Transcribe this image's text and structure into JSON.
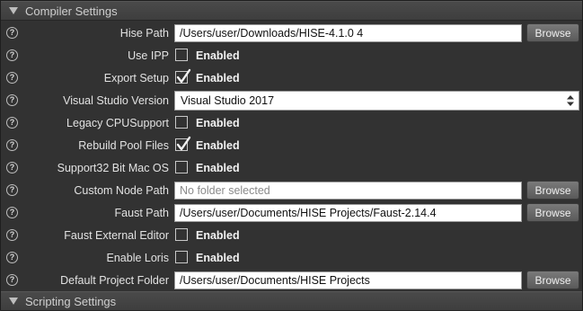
{
  "sections": {
    "compiler": {
      "title": "Compiler Settings"
    },
    "scripting": {
      "title": "Scripting Settings"
    }
  },
  "help_glyph": "?",
  "enabled_label": "Enabled",
  "browse_label": "Browse",
  "rows": {
    "hise_path": {
      "label": "Hise Path",
      "value": "/Users/user/Downloads/HISE-4.1.0 4"
    },
    "use_ipp": {
      "label": "Use IPP",
      "checked": false
    },
    "export_setup": {
      "label": "Export Setup",
      "checked": true
    },
    "visual_studio_version": {
      "label": "Visual Studio Version",
      "value": "Visual Studio 2017"
    },
    "legacy_cpu_support": {
      "label": "Legacy CPUSupport",
      "checked": false
    },
    "rebuild_pool_files": {
      "label": "Rebuild Pool Files",
      "checked": true
    },
    "support32_bit_mac_os": {
      "label": "Support32 Bit Mac OS",
      "checked": false
    },
    "custom_node_path": {
      "label": "Custom Node Path",
      "placeholder": "No folder selected"
    },
    "faust_path": {
      "label": "Faust Path",
      "value": "/Users/user/Documents/HISE Projects/Faust-2.14.4"
    },
    "faust_external_editor": {
      "label": "Faust External Editor",
      "checked": false
    },
    "enable_loris": {
      "label": "Enable Loris",
      "checked": false
    },
    "default_project_folder": {
      "label": "Default Project Folder",
      "value": "/Users/user/Documents/HISE Projects"
    }
  }
}
